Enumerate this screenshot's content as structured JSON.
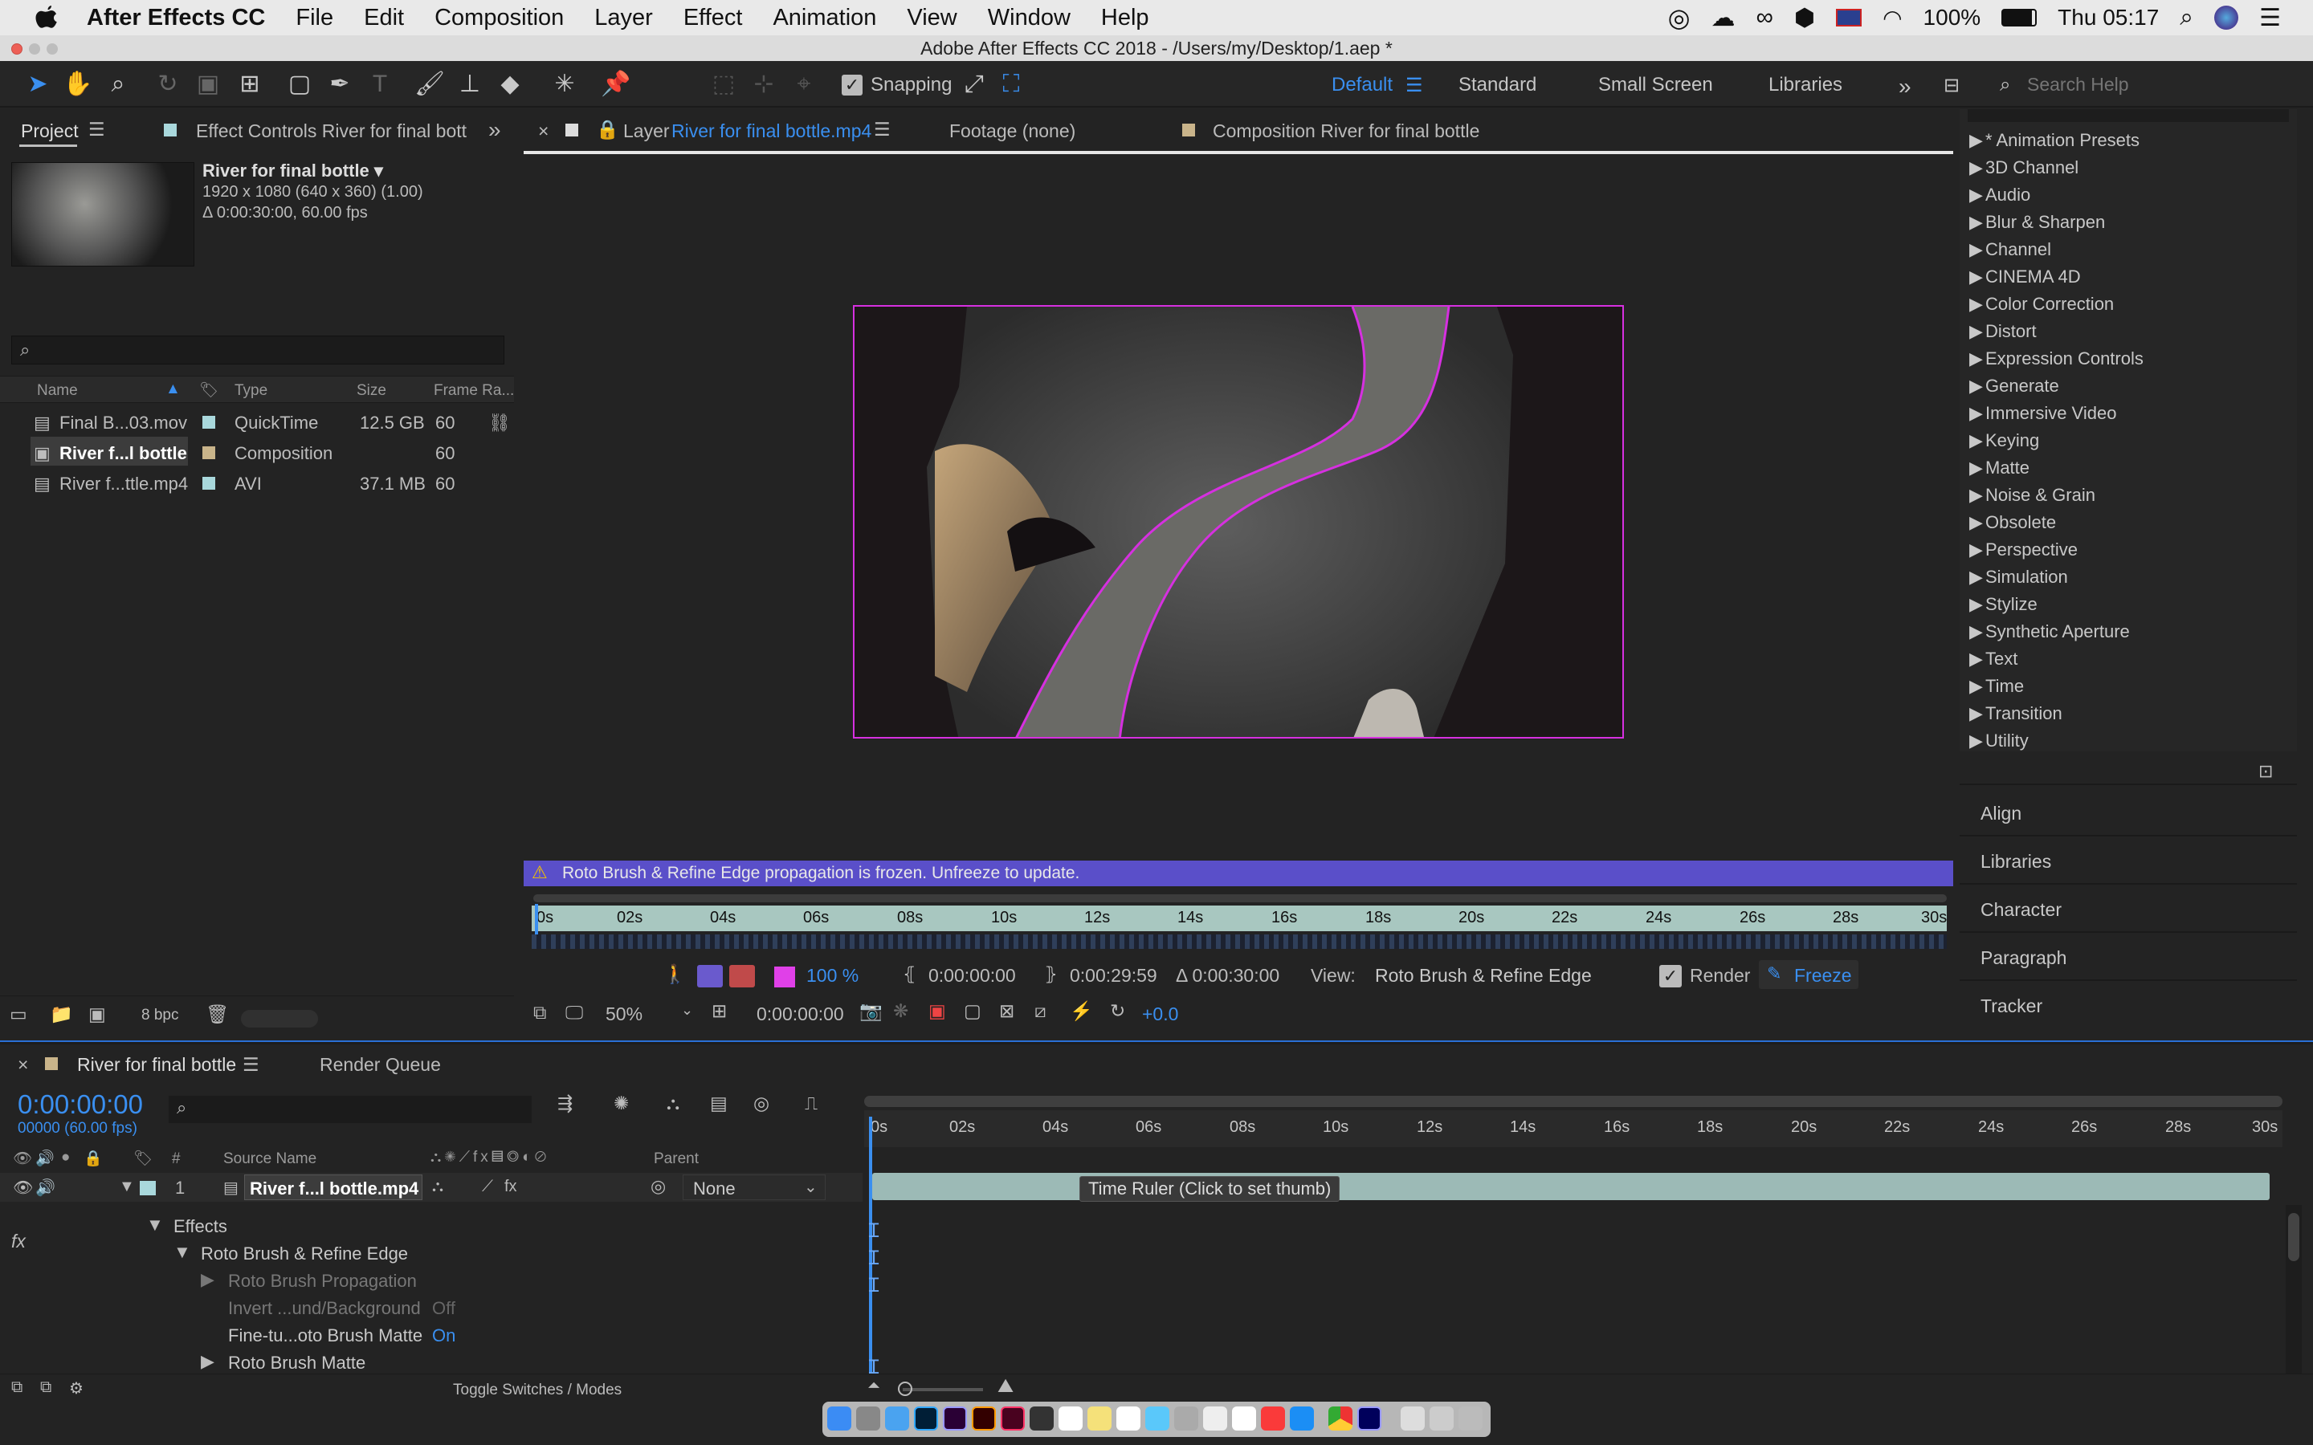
{
  "menubar": {
    "app": "After Effects CC",
    "items": [
      "File",
      "Edit",
      "Composition",
      "Layer",
      "Effect",
      "Animation",
      "View",
      "Window",
      "Help"
    ],
    "battery": "100%",
    "clock": "Thu 05:17"
  },
  "window": {
    "title": "Adobe After Effects CC 2018 - /Users/my/Desktop/1.aep *"
  },
  "toolbar": {
    "snapping": "Snapping",
    "workspaces": [
      "Default",
      "Standard",
      "Small Screen",
      "Libraries"
    ],
    "search_placeholder": "Search Help"
  },
  "project": {
    "tab": "Project",
    "effect_controls_tab": "Effect Controls River for final bott",
    "item_name": "River for final bottle ▾",
    "item_info1": "1920 x 1080  (640 x 360) (1.00)",
    "item_info2": "Δ 0:00:30:00, 60.00 fps",
    "columns": {
      "name": "Name",
      "type": "Type",
      "size": "Size",
      "frame_rate": "Frame Ra..."
    },
    "rows": [
      {
        "name": "Final B...03.mov",
        "type": "QuickTime",
        "size": "12.5 GB",
        "fr": "60",
        "color": "#a9d8dc"
      },
      {
        "name": "River f...l bottle",
        "type": "Composition",
        "size": "",
        "fr": "60",
        "color": "#c9b48a"
      },
      {
        "name": "River f...ttle.mp4",
        "type": "AVI",
        "size": "37.1 MB",
        "fr": "60",
        "color": "#a9d8dc"
      }
    ],
    "bpc": "8 bpc"
  },
  "viewer": {
    "layer_tab_prefix": "Layer",
    "layer_tab_name": "River for final bottle.mp4",
    "footage_tab": "Footage (none)",
    "comp_tab": "Composition River for final bottle",
    "warning": "Roto Brush & Refine Edge propagation is frozen. Unfreeze to update.",
    "ruler": [
      "0s",
      "02s",
      "04s",
      "06s",
      "08s",
      "10s",
      "12s",
      "14s",
      "16s",
      "18s",
      "20s",
      "22s",
      "24s",
      "26s",
      "28s",
      "30s"
    ],
    "zoom_pct": "100 %",
    "in_time": "0:00:00:00",
    "out_time": "0:00:29:59",
    "duration": "Δ 0:00:30:00",
    "view_label": "View:",
    "view_value": "Roto Brush & Refine Edge",
    "render": "Render",
    "freeze": "Freeze",
    "mag": "50%",
    "current_time": "0:00:00:00",
    "exposure": "+0.0"
  },
  "effects": {
    "items": [
      "* Animation Presets",
      "3D Channel",
      "Audio",
      "Blur & Sharpen",
      "Channel",
      "CINEMA 4D",
      "Color Correction",
      "Distort",
      "Expression Controls",
      "Generate",
      "Immersive Video",
      "Keying",
      "Matte",
      "Noise & Grain",
      "Obsolete",
      "Perspective",
      "Simulation",
      "Stylize",
      "Synthetic Aperture",
      "Text",
      "Time",
      "Transition",
      "Utility"
    ],
    "side_panels": [
      "Align",
      "Libraries",
      "Character",
      "Paragraph",
      "Tracker"
    ]
  },
  "timeline": {
    "comp_tab": "River for final bottle",
    "render_queue_tab": "Render Queue",
    "timecode": "0:00:00:00",
    "frames": "00000 (60.00 fps)",
    "col_source": "Source Name",
    "col_parent": "Parent",
    "layer_num": "1",
    "layer_name": "River f...l bottle.mp4",
    "parent_value": "None",
    "props": {
      "effects": "Effects",
      "roto": "Roto Brush & Refine Edge",
      "propagation": "Roto Brush Propagation",
      "invert": "Invert ...und/Background",
      "invert_val": "Off",
      "finetune": "Fine-tu...oto Brush Matte",
      "finetune_val": "On",
      "matte": "Roto Brush Matte"
    },
    "ruler": [
      "0s",
      "02s",
      "04s",
      "06s",
      "08s",
      "10s",
      "12s",
      "14s",
      "16s",
      "18s",
      "20s",
      "22s",
      "24s",
      "26s",
      "28s",
      "30s"
    ],
    "tooltip": "Time Ruler (Click to set thumb)",
    "toggle": "Toggle Switches / Modes"
  }
}
